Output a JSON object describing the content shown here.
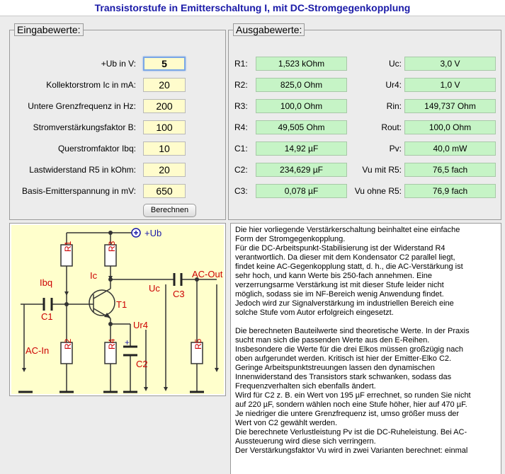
{
  "title": "Transistorstufe in Emitterschaltung I, mit DC-Stromgegenkopplung",
  "inputs": {
    "legend": "Eingabewerte:",
    "fields": [
      {
        "label": "+Ub in V:",
        "value": "5"
      },
      {
        "label": "Kollektorstrom Ic in mA:",
        "value": "20"
      },
      {
        "label": "Untere Grenzfrequenz in Hz:",
        "value": "200"
      },
      {
        "label": "Stromverstärkungsfaktor B:",
        "value": "100"
      },
      {
        "label": "Querstromfaktor Ibq:",
        "value": "10"
      },
      {
        "label": "Lastwiderstand R5 in kOhm:",
        "value": "20"
      },
      {
        "label": "Basis-Emitterspannung in mV:",
        "value": "650"
      }
    ],
    "button": "Berechnen"
  },
  "outputs": {
    "legend": "Ausgabewerte:",
    "left": [
      {
        "label": "R1:",
        "value": "1,523 kOhm"
      },
      {
        "label": "R2:",
        "value": "825,0 Ohm"
      },
      {
        "label": "R3:",
        "value": "100,0 Ohm"
      },
      {
        "label": "R4:",
        "value": "49,505 Ohm"
      },
      {
        "label": "C1:",
        "value": "14,92 µF"
      },
      {
        "label": "C2:",
        "value": "234,629 µF"
      },
      {
        "label": "C3:",
        "value": "0,078 µF"
      }
    ],
    "right": [
      {
        "label": "Uc:",
        "value": "3,0 V"
      },
      {
        "label": "Ur4:",
        "value": "1,0 V"
      },
      {
        "label": "Rin:",
        "value": "149,737 Ohm"
      },
      {
        "label": "Rout:",
        "value": "100,0 Ohm"
      },
      {
        "label": "Pv:",
        "value": "40,0 mW"
      },
      {
        "label": "Vu mit R5:",
        "value": "76,5 fach"
      },
      {
        "label": "Vu ohne R5:",
        "value": "76,9 fach"
      }
    ]
  },
  "schematic": {
    "ub": "+Ub",
    "r1": "R1",
    "r2": "R2",
    "r3": "R3",
    "r4": "R4",
    "r5": "R5",
    "c1": "C1",
    "c2": "C2",
    "c3": "C3",
    "t1": "T1",
    "ibq": "Ibq",
    "ic": "Ic",
    "uc": "Uc",
    "ur4": "Ur4",
    "ac_in": "AC-In",
    "ac_out": "AC-Out",
    "plus": "+"
  },
  "description": {
    "p1": [
      "Die hier vorliegende Verstärkerschaltung beinhaltet eine einfache",
      "Form der Stromgegenkopplung.",
      "Für die DC-Arbeitspunkt-Stabilisierung ist der Widerstand R4",
      "verantwortlich. Da dieser mit dem Kondensator C2 parallel liegt,",
      "findet keine AC-Gegenkopplung statt, d. h., die AC-Verstärkung ist",
      "sehr hoch, und kann Werte bis 250-fach annehmen. Eine",
      "verzerrungsarme Verstärkung ist mit dieser Stufe leider nicht",
      "möglich, sodass sie im NF-Bereich wenig Anwendung findet.",
      "Jedoch wird zur Signalverstärkung im industriellen Bereich eine",
      "solche Stufe vom Autor erfolgreich eingesetzt."
    ],
    "p2": [
      "Die berechneten Bauteilwerte sind theoretische Werte. In der Praxis",
      "sucht man sich die passenden Werte aus den E-Reihen.",
      "Insbesondere die Werte für die drei Elkos müssen großzügig nach",
      "oben aufgerundet werden. Kritisch ist hier der Emitter-Elko C2.",
      "Geringe Arbeitspunktstreuungen lassen den dynamischen",
      "Innenwiderstand des Transistors stark schwanken, sodass das",
      "Frequenzverhalten sich ebenfalls ändert.",
      "Wird für C2 z. B. ein Wert von 195 µF errechnet, so runden Sie nicht",
      "auf 220 µF, sondern wählen noch eine Stufe höher, hier auf 470 µF.",
      "Je niedriger die untere Grenzfrequenz ist, umso größer muss der",
      "Wert von C2 gewählt werden.",
      "Die berechnete Verlustleistung Pv ist die DC-Ruheleistung. Bei AC-",
      "Aussteuerung wird diese sich verringern.",
      "Der Verstärkungsfaktor Vu wird in zwei Varianten berechnet: einmal"
    ]
  }
}
